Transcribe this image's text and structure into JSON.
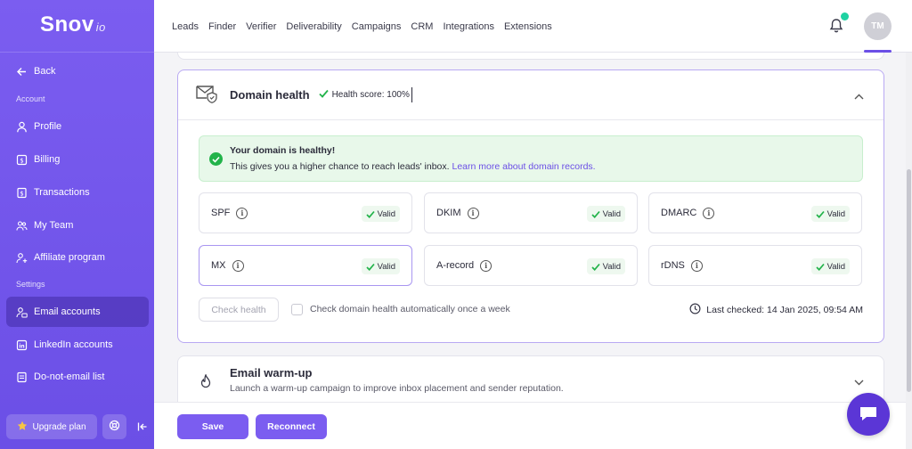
{
  "brand": {
    "name": "Snov",
    "suffix": "io"
  },
  "sidebar": {
    "back_label": "Back",
    "account_section": "Account",
    "settings_section": "Settings",
    "items": [
      {
        "label": "Profile",
        "icon": "user-icon"
      },
      {
        "label": "Billing",
        "icon": "billing-icon"
      },
      {
        "label": "Transactions",
        "icon": "transactions-icon"
      },
      {
        "label": "My Team",
        "icon": "team-icon"
      },
      {
        "label": "Affiliate program",
        "icon": "affiliate-icon"
      },
      {
        "label": "Email accounts",
        "icon": "email-accounts-icon",
        "active": true
      },
      {
        "label": "LinkedIn accounts",
        "icon": "linkedin-icon"
      },
      {
        "label": "Do-not-email list",
        "icon": "list-icon"
      }
    ],
    "upgrade_label": "Upgrade plan"
  },
  "topnav": {
    "links": [
      "Leads",
      "Finder",
      "Verifier",
      "Deliverability",
      "Campaigns",
      "CRM",
      "Integrations",
      "Extensions"
    ],
    "avatar_initials": "TM"
  },
  "domain_health": {
    "title": "Domain health",
    "score_label": "Health score: 100%",
    "alert_title": "Your domain is healthy!",
    "alert_text": "This gives you a higher chance to reach leads' inbox.",
    "alert_link": "Learn more about domain records.",
    "records": [
      {
        "name": "SPF",
        "status": "Valid"
      },
      {
        "name": "DKIM",
        "status": "Valid"
      },
      {
        "name": "DMARC",
        "status": "Valid"
      },
      {
        "name": "MX",
        "status": "Valid"
      },
      {
        "name": "A-record",
        "status": "Valid"
      },
      {
        "name": "rDNS",
        "status": "Valid"
      }
    ],
    "check_button": "Check health",
    "auto_check_label": "Check domain health automatically once a week",
    "last_checked": "Last checked: 14 Jan 2025, 09:54 AM"
  },
  "warmup": {
    "title": "Email warm-up",
    "subtitle": "Launch a warm-up campaign to improve inbox placement and sender reputation."
  },
  "footer": {
    "save_label": "Save",
    "reconnect_label": "Reconnect"
  },
  "colors": {
    "accent": "#7b5df0",
    "success": "#22b34a",
    "chat": "#5b36d6"
  }
}
